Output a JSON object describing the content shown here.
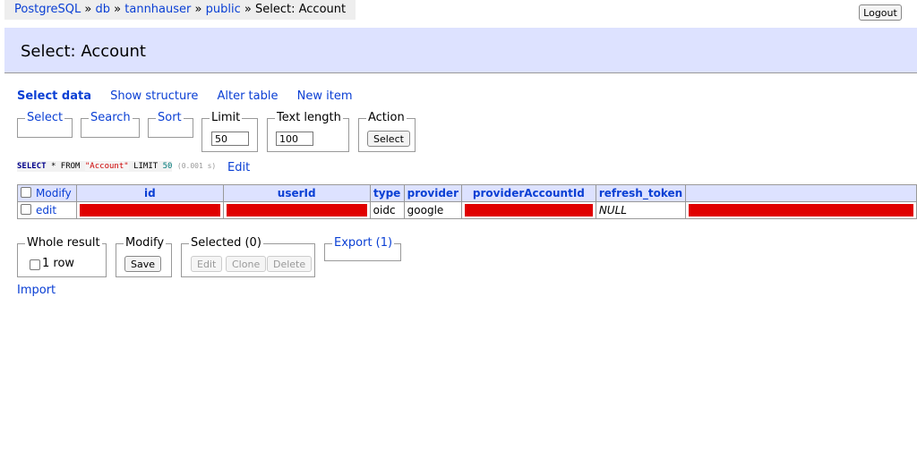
{
  "breadcrumb": {
    "items": [
      "PostgreSQL",
      "db",
      "tannhauser",
      "public"
    ],
    "separator": "»",
    "current": "Select: Account"
  },
  "logout_label": "Logout",
  "page_title": "Select: Account",
  "nav": {
    "select_data": "Select data",
    "show_structure": "Show structure",
    "alter_table": "Alter table",
    "new_item": "New item"
  },
  "filters": {
    "select_label": "Select",
    "search_label": "Search",
    "sort_label": "Sort",
    "limit_label": "Limit",
    "limit_value": "50",
    "text_length_label": "Text length",
    "text_length_value": "100",
    "action_label": "Action",
    "action_button": "Select"
  },
  "sql": {
    "select_kw": "SELECT",
    "star": "*",
    "from_kw": "FROM",
    "table": "\"Account\"",
    "limit_kw": "LIMIT",
    "limit_num": "50",
    "time": "(0.001 s)",
    "edit_label": "Edit"
  },
  "table": {
    "modify_header": "Modify",
    "columns": [
      "id",
      "userId",
      "type",
      "provider",
      "providerAccountId",
      "refresh_token",
      ""
    ],
    "rows": [
      {
        "edit_label": "edit",
        "type": "oidc",
        "provider": "google",
        "refresh_token": "NULL"
      }
    ]
  },
  "bottom": {
    "whole_result_label": "Whole result",
    "row_count_label": "1 row",
    "modify_label": "Modify",
    "save_button": "Save",
    "selected_label": "Selected (0)",
    "edit_button": "Edit",
    "clone_button": "Clone",
    "delete_button": "Delete",
    "export_label": "Export (1)",
    "import_label": "Import"
  },
  "colors": {
    "link": "#0a3fd4",
    "header_bg": "#dde2ff",
    "redaction": "#e00000"
  }
}
